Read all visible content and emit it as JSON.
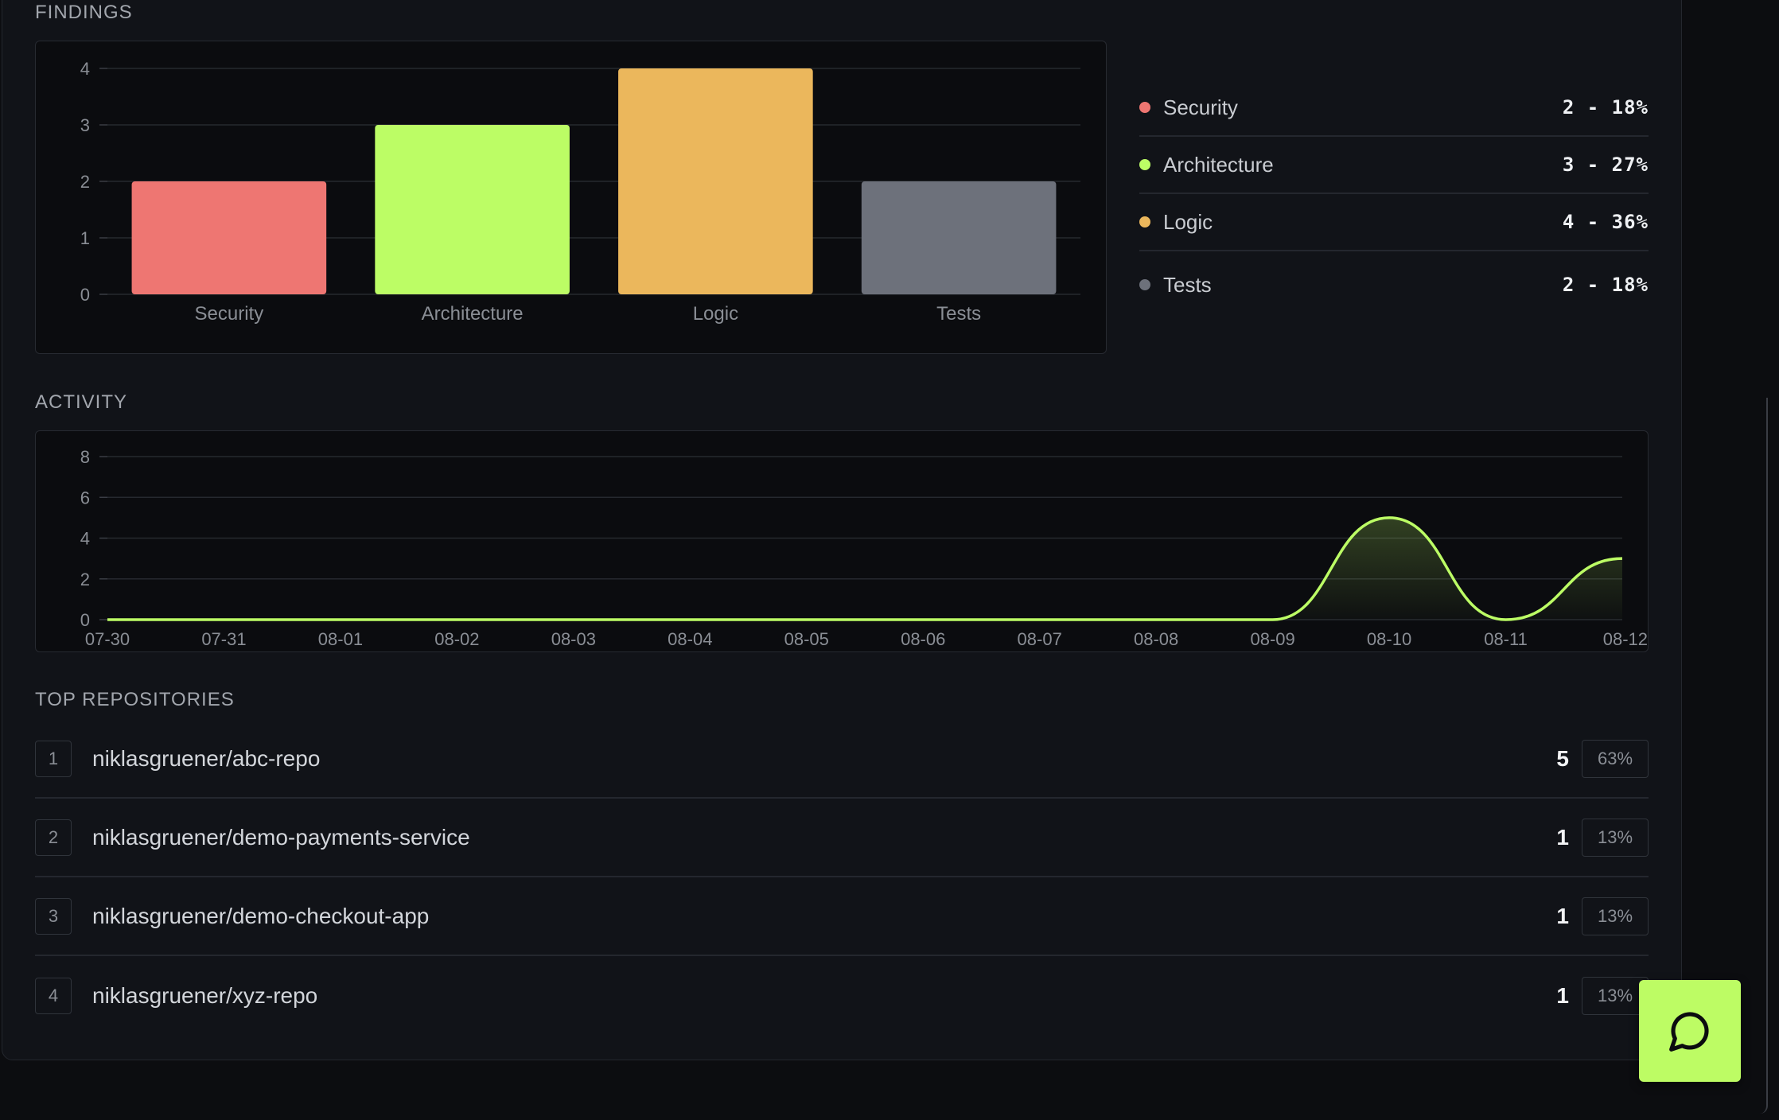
{
  "findings": {
    "title": "FINDINGS",
    "legend": [
      {
        "label": "Security",
        "value": "2 - 18%",
        "color": "#ee7672"
      },
      {
        "label": "Architecture",
        "value": "3 - 27%",
        "color": "#bcfd65"
      },
      {
        "label": "Logic",
        "value": "4 - 36%",
        "color": "#ebb75c"
      },
      {
        "label": "Tests",
        "value": "2 - 18%",
        "color": "#6d717b"
      }
    ]
  },
  "activity": {
    "title": "ACTIVITY"
  },
  "chart_data": [
    {
      "type": "bar",
      "categories": [
        "Security",
        "Architecture",
        "Logic",
        "Tests"
      ],
      "values": [
        2,
        3,
        4,
        2
      ],
      "colors": [
        "#ee7672",
        "#bcfd65",
        "#ebb75c",
        "#6d717b"
      ],
      "yticks": [
        "0",
        "1",
        "2",
        "3",
        "4"
      ],
      "ylim": [
        0,
        4
      ],
      "grid": true
    },
    {
      "type": "area",
      "x": [
        "07-30",
        "07-31",
        "08-01",
        "08-02",
        "08-03",
        "08-04",
        "08-05",
        "08-06",
        "08-07",
        "08-08",
        "08-09",
        "08-10",
        "08-11",
        "08-12"
      ],
      "values": [
        0,
        0,
        0,
        0,
        0,
        0,
        0,
        0,
        0,
        0,
        0,
        5,
        0,
        3
      ],
      "color": "#bcfd65",
      "yticks": [
        "0",
        "2",
        "4",
        "6",
        "8"
      ],
      "ylim": [
        0,
        8
      ],
      "grid": true
    }
  ],
  "repositories": {
    "title": "TOP REPOSITORIES",
    "items": [
      {
        "rank": "1",
        "name": "niklasgruener/abc-repo",
        "count": "5",
        "percent": "63%"
      },
      {
        "rank": "2",
        "name": "niklasgruener/demo-payments-service",
        "count": "1",
        "percent": "13%"
      },
      {
        "rank": "3",
        "name": "niklasgruener/demo-checkout-app",
        "count": "1",
        "percent": "13%"
      },
      {
        "rank": "4",
        "name": "niklasgruener/xyz-repo",
        "count": "1",
        "percent": "13%"
      }
    ]
  },
  "chat_button": {
    "icon": "chat-bubble-icon"
  }
}
